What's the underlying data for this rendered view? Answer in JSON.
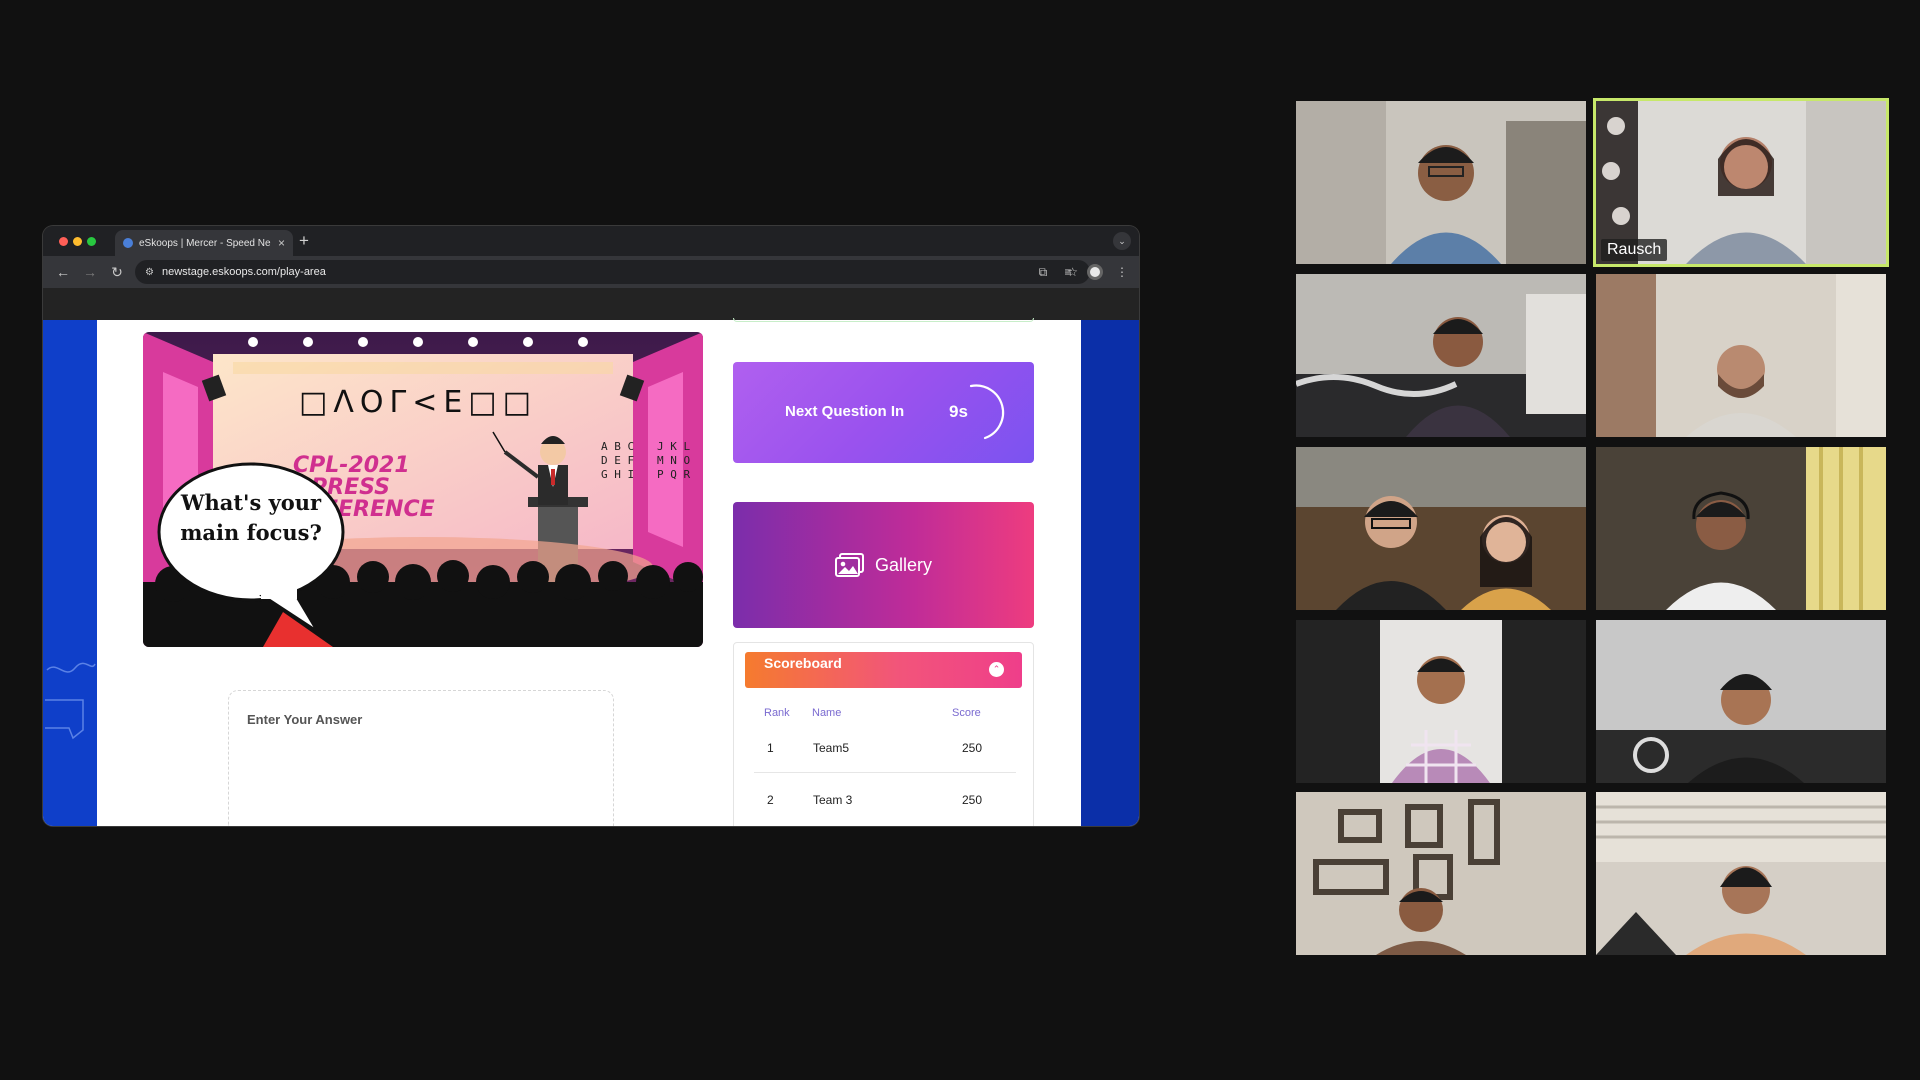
{
  "browser": {
    "tab_title": "eSkoops | Mercer - Speed Ne",
    "url": "newstage.eskoops.com/play-area"
  },
  "quiz": {
    "image": {
      "logo_text": "□ΛΟΓ<Ε□□",
      "banner_line1": "CPL-2021",
      "banner_line2": "PRESS",
      "banner_line3": "FERENCE",
      "speech_bubble": "What's your main focus?"
    },
    "answer_placeholder": "Enter Your Answer"
  },
  "next_question": {
    "label": "Next Question In",
    "timer": "9s"
  },
  "gallery": {
    "label": "Gallery"
  },
  "scoreboard": {
    "title": "Scoreboard",
    "columns": {
      "rank": "Rank",
      "name": "Name",
      "score": "Score"
    },
    "rows": [
      {
        "rank": "1",
        "name": "Team5",
        "score": "250"
      },
      {
        "rank": "2",
        "name": "Team 3",
        "score": "250"
      }
    ]
  },
  "video_grid": {
    "active_speaker": "Rausch",
    "participant_count": 10
  }
}
